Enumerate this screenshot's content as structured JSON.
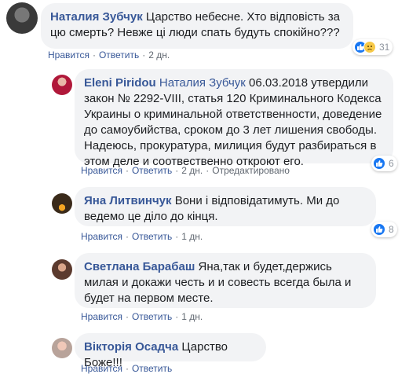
{
  "comments": [
    {
      "author": "Наталия Зубчук",
      "mention": "",
      "text": "Царство небесне. Хто відповість за цю смерть? Невже ці люди спать будуть спокійно???",
      "actions": {
        "like": "Нравится",
        "reply": "Ответить",
        "time": "2 дн.",
        "edited": ""
      },
      "reactions": {
        "count": "31",
        "icons": [
          "like-icon",
          "sad-icon"
        ]
      }
    },
    {
      "author": "Eleni Piridou",
      "mention": "Наталия Зубчук",
      "text": "06.03.2018 утвердили закон № 2292-VIII, статья 120 Криминального Кодекса Украины о криминальной ответственности, доведение до самоубийства, сроком до 3 лет лишения свободы. Надеюсь, прокуратура, милиция будут разбираться в этом деле и соотвественно откроют его.",
      "actions": {
        "like": "Нравится",
        "reply": "Ответить",
        "time": "2 дн.",
        "edited": "Отредактировано"
      },
      "reactions": {
        "count": "6",
        "icons": [
          "like-icon"
        ]
      }
    },
    {
      "author": "Яна Литвинчук",
      "mention": "",
      "text": "Вони і відповідатимуть. Ми до ведемо це діло до кінця.",
      "actions": {
        "like": "Нравится",
        "reply": "Ответить",
        "time": "1 дн.",
        "edited": ""
      },
      "reactions": {
        "count": "8",
        "icons": [
          "like-icon"
        ]
      }
    },
    {
      "author": "Светлана Барабаш",
      "mention": "",
      "text": "Яна,так и будет,держись милая и докажи честь и и совесть всегда была и будет на первом месте.",
      "actions": {
        "like": "Нравится",
        "reply": "Ответить",
        "time": "1 дн.",
        "edited": ""
      },
      "reactions": {
        "count": "",
        "icons": []
      }
    },
    {
      "author": "Вікторія Осадча",
      "mention": "",
      "text": "Царство Боже!!!",
      "actions": {
        "like": "Нравится",
        "reply": "Ответить",
        "time": "",
        "edited": ""
      },
      "reactions": {
        "count": "",
        "icons": []
      }
    }
  ],
  "colors": {
    "link": "#385898",
    "bubble": "#f2f3f5",
    "meta": "#606770",
    "like": "#1877f2"
  }
}
